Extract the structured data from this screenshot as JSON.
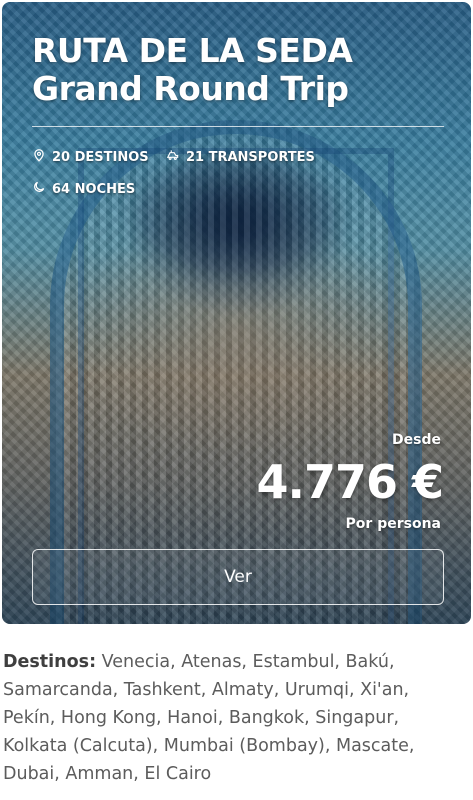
{
  "card": {
    "title_line1": "RUTA DE LA SEDA",
    "title_line2": "Grand Round Trip",
    "stats": {
      "destinos": "20 DESTINOS",
      "transportes": "21 TRANSPORTES",
      "noches": "64 NOCHES"
    },
    "icons": {
      "destinos": "map-pin-icon",
      "transportes": "transport-icon",
      "noches": "moon-icon"
    },
    "price_prefix": "Desde",
    "price": "4.776 €",
    "price_suffix": "Por persona",
    "button_label": "Ver"
  },
  "destinations": {
    "label": "Destinos:",
    "list": " Venecia, Atenas, Estambul, Bakú, Samarcanda, Tashkent, Almaty, Urumqi, Xi'an, Pekín, Hong Kong, Hanoi, Bangkok, Singapur, Kolkata (Calcuta), Mumbai (Bombay), Mascate, Dubai, Amman, El Cairo"
  },
  "colors": {
    "text_white": "#ffffff",
    "body_text": "#5c5c5c"
  }
}
